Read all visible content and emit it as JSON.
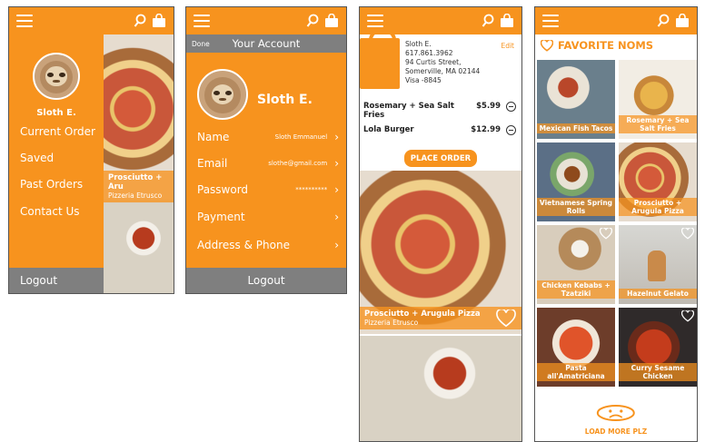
{
  "colors": {
    "accent": "#f7931e",
    "gray": "#7f7f7f",
    "white": "#ffffff"
  },
  "menu_screen": {
    "user_name": "Sloth E.",
    "items": [
      {
        "label": "Current Order"
      },
      {
        "label": "Saved"
      },
      {
        "label": "Past Orders"
      },
      {
        "label": "Contact Us"
      }
    ],
    "logout_label": "Logout",
    "peek_caption": {
      "title": "Prosciutto + Aru",
      "subtitle": "Pizzeria Etrusco"
    }
  },
  "account_screen": {
    "done_label": "Done",
    "title": "Your Account",
    "user_name": "Sloth E.",
    "rows": [
      {
        "label": "Name",
        "value": "Sloth Emmanuel"
      },
      {
        "label": "Email",
        "value": "slothe@gmail.com"
      },
      {
        "label": "Password",
        "value": "**********"
      },
      {
        "label": "Payment",
        "value": ""
      },
      {
        "label": "Address & Phone",
        "value": ""
      }
    ],
    "logout_label": "Logout"
  },
  "order_screen": {
    "address_lines": [
      "Sloth E.",
      "617.861.3962",
      "94 Curtis Street,",
      "Somerville, MA 02144",
      "Visa -8845"
    ],
    "edit_label": "Edit",
    "items": [
      {
        "name": "Rosemary + Sea Salt Fries",
        "price": "$5.99"
      },
      {
        "name": "Lola Burger",
        "price": "$12.99"
      }
    ],
    "place_order_label": "PLACE ORDER",
    "feature_caption": {
      "title": "Prosciutto + Arugula Pizza",
      "subtitle": "Pizzeria Etrusco"
    }
  },
  "favorites_screen": {
    "title": "FAVORITE NOMS",
    "tiles": [
      {
        "label": "Mexican Fish Tacos"
      },
      {
        "label": "Rosemary + Sea Salt Fries"
      },
      {
        "label": "Vietnamese Spring Rolls"
      },
      {
        "label": "Prosciutto + Arugula Pizza"
      },
      {
        "label": "Chicken Kebabs + Tzatziki"
      },
      {
        "label": "Hazelnut Gelato"
      },
      {
        "label": "Pasta all'Amatriciana"
      },
      {
        "label": "Curry Sesame Chicken"
      }
    ],
    "load_more_label": "LOAD MORE PLZ"
  },
  "icons": {
    "menu": "hamburger-menu-icon",
    "search": "search-icon",
    "bag": "shopping-bag-icon",
    "heart": "heart-icon",
    "chevron": "chevron-right-icon",
    "minus": "minus-circle-icon"
  }
}
